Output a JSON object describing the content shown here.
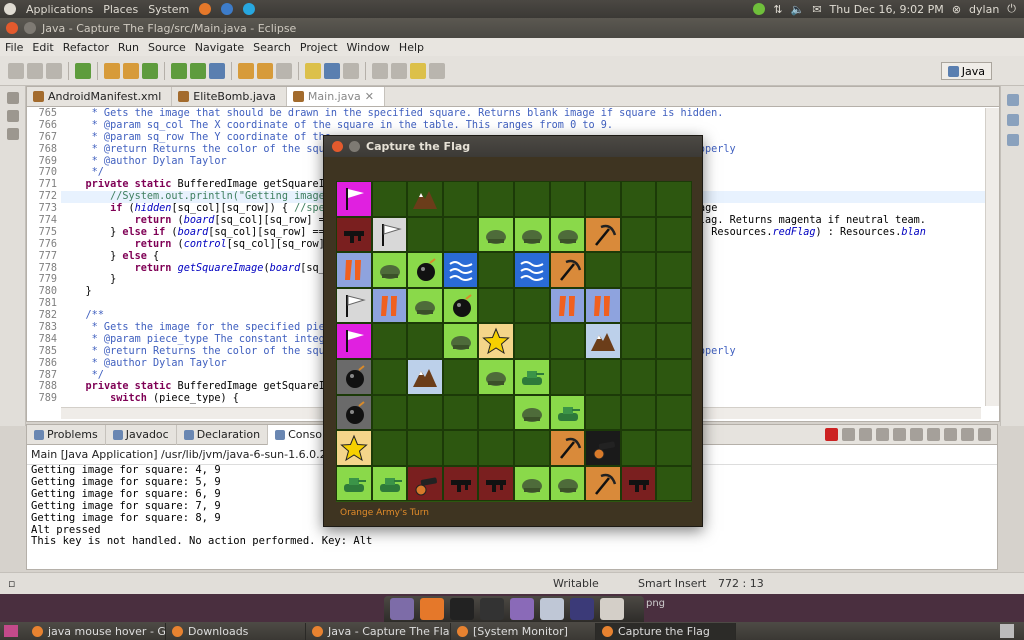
{
  "topbar": {
    "menus": [
      "Applications",
      "Places",
      "System"
    ],
    "datetime": "Thu Dec 16,  9:02 PM",
    "user": "dylan"
  },
  "window": {
    "title": "Java - Capture The Flag/src/Main.java - Eclipse"
  },
  "menubar": [
    "File",
    "Edit",
    "Refactor",
    "Run",
    "Source",
    "Navigate",
    "Search",
    "Project",
    "Window",
    "Help"
  ],
  "perspective": "Java",
  "editor": {
    "tabs": [
      {
        "label": "AndroidManifest.xml",
        "active": false
      },
      {
        "label": "EliteBomb.java",
        "active": false
      },
      {
        "label": "Main.java",
        "active": true
      }
    ],
    "lines": [
      {
        "n": "765",
        "html": "<span class='jd'>     * Gets the image that should be drawn in the specified square. Returns blank image if square is hidden.</span>"
      },
      {
        "n": "766",
        "html": "<span class='jd'>     * @param sq_col The X coordinate of the square in the table. This ranges from 0 to 9.</span>"
      },
      {
        "n": "767",
        "html": "<span class='jd'>     * @param sq_row The Y coordinate of the</span>"
      },
      {
        "n": "768",
        "html": "<span class='jd'>     * @return Returns the color of the squa                                                     dled properly</span>"
      },
      {
        "n": "769",
        "html": "<span class='jd'>     * @author Dylan Taylor</span>"
      },
      {
        "n": "770",
        "html": "<span class='jd'>     */</span>"
      },
      {
        "n": "771",
        "html": "    <span class='kw'>private static</span> BufferedImage getSquareIm"
      },
      {
        "n": "772",
        "html": "        <span class='cm'>//System.out.println(\"Getting image</span>",
        "hl": true
      },
      {
        "n": "773",
        "html": "        <span class='kw'>if</span> (<span class='it'>hidden</span>[sq_col][sq_row]) { <span class='cm'>//spec</span>                                                    quare image"
      },
      {
        "n": "774",
        "html": "            <span class='kw'>return</span> (<span class='it'>board</span>[sq_col][sq_row] ==                                                   colored flag. Returns magenta if neutral team."
      },
      {
        "n": "775",
        "html": "        } <span class='kw'>else if</span> (<span class='it'>board</span>[sq_col][sq_row] ==                                                  <span class='it'>orangeFlag</span> : Resources.<span class='it'>redFlag</span>) : Resources.<span class='it'>blan</span>"
      },
      {
        "n": "776",
        "html": "            <span class='kw'>return</span> (<span class='it'>control</span>[sq_col][sq_row]"
      },
      {
        "n": "777",
        "html": "        } <span class='kw'>else</span> {                                                                            re"
      },
      {
        "n": "778",
        "html": "            <span class='kw'>return</span> <span class='it'>getSquareImage</span>(<span class='it'>board</span>[sq_c"
      },
      {
        "n": "779",
        "html": "        }"
      },
      {
        "n": "780",
        "html": "    }"
      },
      {
        "n": "781",
        "html": ""
      },
      {
        "n": "782",
        "html": "    <span class='jd'>/**</span>"
      },
      {
        "n": "783",
        "html": "<span class='jd'>     * Gets the image for the specified piec</span>"
      },
      {
        "n": "784",
        "html": "<span class='jd'>     * @param piece_type The constant intege</span>"
      },
      {
        "n": "785",
        "html": "<span class='jd'>     * @return Returns the color of the squa                                                     dled properly</span>"
      },
      {
        "n": "786",
        "html": "<span class='jd'>     * @author Dylan Taylor</span>"
      },
      {
        "n": "787",
        "html": "<span class='jd'>     */</span>"
      },
      {
        "n": "788",
        "html": "    <span class='kw'>private static</span> BufferedImage getSquareIm"
      },
      {
        "n": "789",
        "html": "        <span class='kw'>switch</span> (piece_type) {"
      }
    ]
  },
  "console": {
    "tabs": [
      "Problems",
      "Javadoc",
      "Declaration",
      "Console"
    ],
    "header": "Main [Java Application] /usr/lib/jvm/java-6-sun-1.6.0.22/bin/jav",
    "lines": [
      "Getting image for square: 4, 9",
      "Getting image for square: 5, 9",
      "Getting image for square: 6, 9",
      "Getting image for square: 7, 9",
      "Getting image for square: 8, 9",
      "Alt pressed",
      "This key is not handled. No action performed. Key: Alt"
    ]
  },
  "status": {
    "writable": "Writable",
    "insert": "Smart Insert",
    "position": "772 : 13"
  },
  "game": {
    "title": "Capture the Flag",
    "status": "Orange Army's Turn",
    "grid": [
      [
        "mflag",
        "g",
        "mtn",
        "g",
        "g",
        "g",
        "g",
        "g",
        "g",
        "g"
      ],
      [
        "gun",
        "wflag",
        "g",
        "g",
        "helm",
        "helm",
        "helm",
        "pick",
        "g",
        "g"
      ],
      [
        "flip",
        "helm",
        "bomb",
        "wave",
        "g",
        "wave",
        "pick",
        "g",
        "g",
        "g"
      ],
      [
        "wflag",
        "flip",
        "helm",
        "bomb",
        "g",
        "g",
        "flip",
        "flip",
        "g",
        "g"
      ],
      [
        "mflag",
        "g",
        "g",
        "helm",
        "star",
        "g",
        "g",
        "mtn",
        "g",
        "g"
      ],
      [
        "bomb",
        "g",
        "mtn",
        "g",
        "helm",
        "tank",
        "g",
        "g",
        "g",
        "g"
      ],
      [
        "bomb",
        "g",
        "g",
        "g",
        "g",
        "helm",
        "tank",
        "g",
        "g",
        "g"
      ],
      [
        "star",
        "g",
        "g",
        "g",
        "g",
        "g",
        "pick",
        "cannon",
        "g",
        "g"
      ],
      [
        "tank",
        "tank",
        "cannon",
        "gun",
        "gun",
        "helm",
        "helm",
        "pick",
        "gun",
        "g"
      ]
    ]
  },
  "taskbar": [
    "java mouse hover - Go...",
    "Downloads",
    "Java - Capture The Fla...",
    "[System Monitor]",
    "Capture the Flag"
  ],
  "dock_label": "png"
}
